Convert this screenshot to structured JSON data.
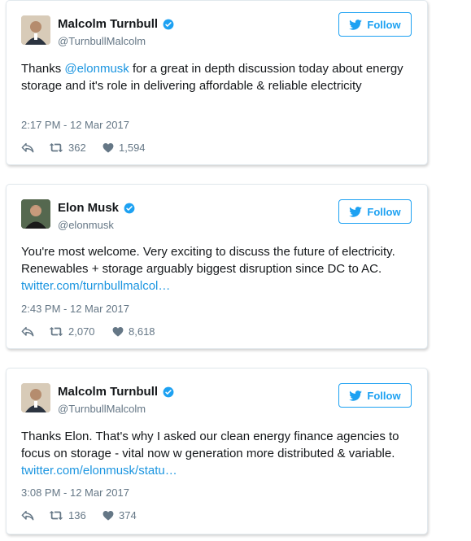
{
  "tweets": [
    {
      "name": "Malcolm Turnbull",
      "handle": "@TurnbullMalcolm",
      "follow_label": "Follow",
      "text_parts": {
        "p1": "Thanks ",
        "mention": "@elonmusk",
        "p2": " for a great in depth discussion today about energy storage and it's role in delivering affordable & reliable electricity"
      },
      "timestamp": "2:17 PM - 12 Mar 2017",
      "retweets": "362",
      "likes": "1,594"
    },
    {
      "name": "Elon Musk",
      "handle": "@elonmusk",
      "follow_label": "Follow",
      "text_parts": {
        "p1": "You're most welcome. Very exciting to discuss the future of electricity. Renewables + storage arguably biggest disruption since DC to AC. ",
        "link": "twitter.com/turnbullmalcol…"
      },
      "timestamp": "2:43 PM - 12 Mar 2017",
      "retweets": "2,070",
      "likes": "8,618"
    },
    {
      "name": "Malcolm Turnbull",
      "handle": "@TurnbullMalcolm",
      "follow_label": "Follow",
      "text_parts": {
        "p1": "Thanks Elon. That's why I asked our clean energy finance agencies to focus on storage - vital now w generation more distributed & variable. ",
        "link": "twitter.com/elonmusk/statu…"
      },
      "timestamp": "3:08 PM - 12 Mar 2017",
      "retweets": "136",
      "likes": "374"
    }
  ],
  "colors": {
    "accent": "#1da1f2",
    "link": "#1b95e0",
    "muted": "#657786",
    "text": "#14171a"
  },
  "icons": [
    "verified-badge-icon",
    "twitter-bird-icon",
    "reply-icon",
    "retweet-icon",
    "heart-icon"
  ]
}
